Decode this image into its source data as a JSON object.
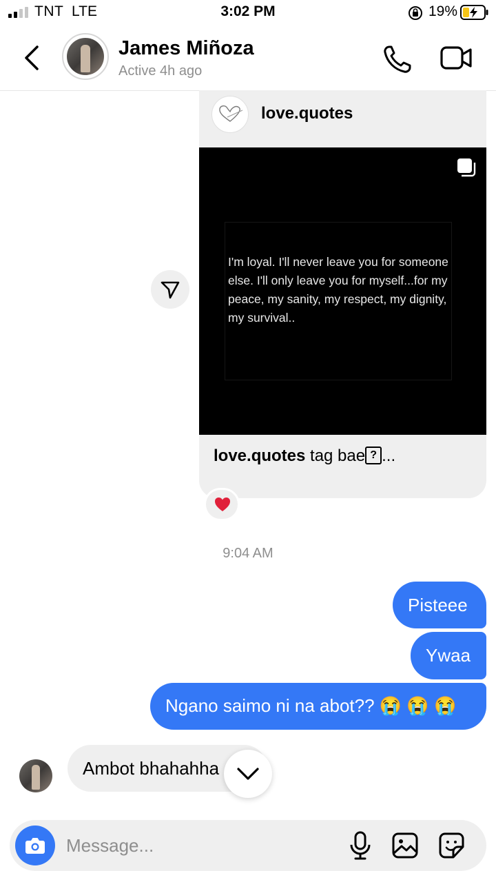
{
  "status_bar": {
    "carrier": "TNT",
    "network": "LTE",
    "time": "3:02 PM",
    "battery_percent": "19%"
  },
  "header": {
    "contact_name": "James Miñoza",
    "active_status": "Active 4h ago",
    "icons": [
      "back-chevron-icon",
      "phone-call-icon",
      "video-call-icon"
    ]
  },
  "shared_post": {
    "username": "love.quotes",
    "quote_text": "I'm loyal. I'll never leave you for someone else. I'll only leave you for myself...for my peace, my sanity, my respect, my dignity, my survival..",
    "caption_user": "love.quotes",
    "caption_text": " tag bae",
    "caption_glyph": "?",
    "caption_ellipsis": "...",
    "reaction": "heart"
  },
  "timestamp": "9:04 AM",
  "messages": {
    "sent": [
      "Pisteee",
      "Ywaa",
      "Ngano saimo ni na abot??"
    ],
    "sent_emoji": "😭 😭 😭",
    "received": [
      "Ambot bhahahha"
    ]
  },
  "composer": {
    "placeholder": "Message..."
  },
  "colors": {
    "accent": "#3478f6",
    "bubble_gray": "#efefef",
    "secondary_text": "#8e8e8e"
  }
}
